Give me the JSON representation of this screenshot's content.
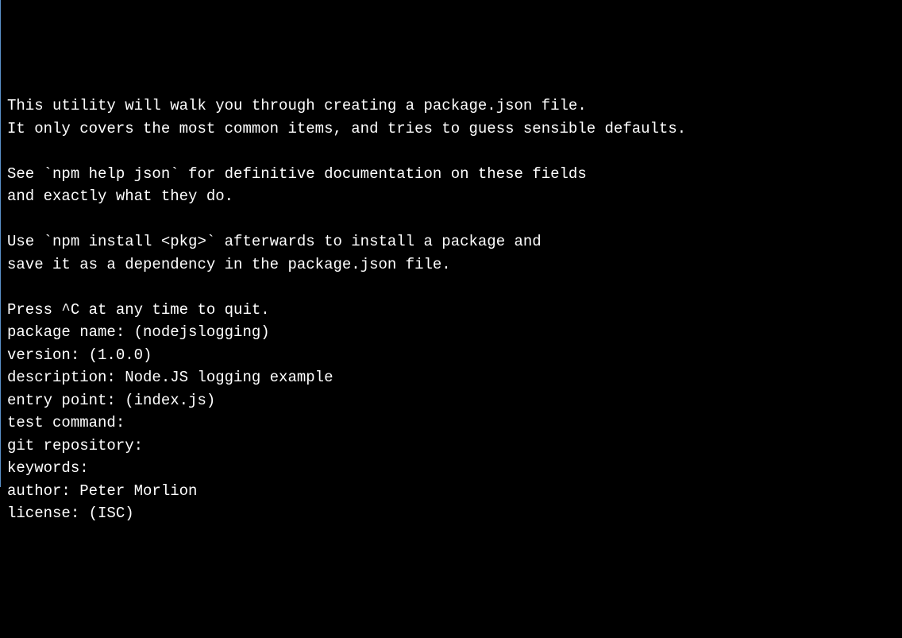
{
  "terminal": {
    "intro": {
      "line1": "This utility will walk you through creating a package.json file.",
      "line2": "It only covers the most common items, and tries to guess sensible defaults.",
      "line3": "",
      "line4": "See `npm help json` for definitive documentation on these fields",
      "line5": "and exactly what they do.",
      "line6": "",
      "line7": "Use `npm install <pkg>` afterwards to install a package and",
      "line8": "save it as a dependency in the package.json file.",
      "line9": "",
      "line10": "Press ^C at any time to quit."
    },
    "prompts": {
      "package_name": "package name: (nodejslogging)",
      "version": "version: (1.0.0)",
      "description": "description: Node.JS logging example",
      "entry_point": "entry point: (index.js)",
      "test_command": "test command:",
      "git_repository": "git repository:",
      "keywords": "keywords:",
      "author": "author: Peter Morlion",
      "license": "license: (ISC)"
    }
  }
}
